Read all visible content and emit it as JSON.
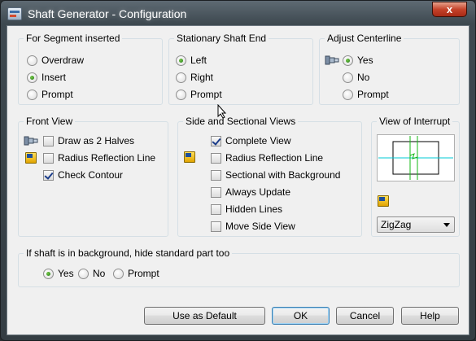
{
  "window": {
    "title": "Shaft Generator - Configuration",
    "close_glyph": "x"
  },
  "segment": {
    "title": "For Segment inserted",
    "options": [
      {
        "label": "Overdraw",
        "checked": false
      },
      {
        "label": "Insert",
        "checked": true
      },
      {
        "label": "Prompt",
        "checked": false
      }
    ]
  },
  "stationary": {
    "title": "Stationary Shaft End",
    "options": [
      {
        "label": "Left",
        "checked": true
      },
      {
        "label": "Right",
        "checked": false
      },
      {
        "label": "Prompt",
        "checked": false
      }
    ]
  },
  "centerline": {
    "title": "Adjust Centerline",
    "options": [
      {
        "label": "Yes",
        "checked": true
      },
      {
        "label": "No",
        "checked": false
      },
      {
        "label": "Prompt",
        "checked": false
      }
    ]
  },
  "front_view": {
    "title": "Front View",
    "options": [
      {
        "label": "Draw as 2 Halves",
        "checked": false
      },
      {
        "label": "Radius Reflection Line",
        "checked": false
      },
      {
        "label": "Check Contour",
        "checked": true
      }
    ]
  },
  "side_view": {
    "title": "Side and Sectional Views",
    "options": [
      {
        "label": "Complete View",
        "checked": true
      },
      {
        "label": "Radius Reflection Line",
        "checked": false
      },
      {
        "label": "Sectional with Background",
        "checked": false
      },
      {
        "label": "Always Update",
        "checked": false
      },
      {
        "label": "Hidden Lines",
        "checked": false
      },
      {
        "label": "Move Side View",
        "checked": false
      }
    ]
  },
  "interrupt": {
    "title": "View of Interrupt",
    "selected": "ZigZag"
  },
  "background": {
    "title": "If shaft is in background, hide standard part too",
    "options": [
      {
        "label": "Yes",
        "checked": true
      },
      {
        "label": "No",
        "checked": false
      },
      {
        "label": "Prompt",
        "checked": false
      }
    ]
  },
  "buttons": {
    "default_label": "Use as Default",
    "ok_label": "OK",
    "cancel_label": "Cancel",
    "help_label": "Help"
  },
  "colors": {
    "title_bar": "#3e4950",
    "dialog_bg": "#f0f0f0",
    "close_red": "#c5432a",
    "radio_green": "#1f7a14",
    "preview_cyan": "#00c8d6",
    "preview_green": "#14b814"
  }
}
